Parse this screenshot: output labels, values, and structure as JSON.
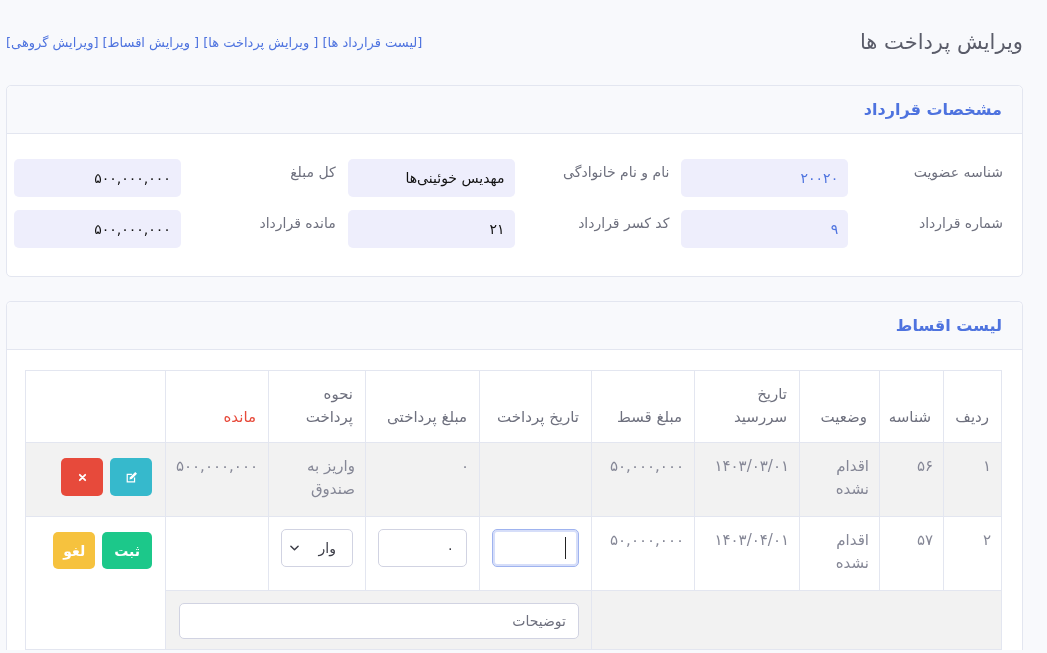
{
  "page": {
    "title": "ویرایش پرداخت ها",
    "links": [
      "[لیست قرارداد ها]",
      "[ ویرایش پرداخت ها]",
      "[ ویرایش اقساط]",
      "[ویرایش گروهی]"
    ]
  },
  "contract": {
    "title": "مشخصات قرارداد",
    "fields": [
      {
        "label": "شناسه عضویت",
        "value": "۲۰۰۲۰",
        "kind": "link"
      },
      {
        "label": "نام و نام خانوادگی",
        "value": "مهدیس خوئینی‌ها",
        "kind": "text"
      },
      {
        "label": "کل مبلغ",
        "value": "۵۰۰,۰۰۰,۰۰۰",
        "kind": "text"
      },
      {
        "label": "شماره قرارداد",
        "value": "۹",
        "kind": "link"
      },
      {
        "label": "کد کسر قرارداد",
        "value": "۲۱",
        "kind": "text"
      },
      {
        "label": "مانده قرارداد",
        "value": "۵۰۰,۰۰۰,۰۰۰",
        "kind": "text"
      }
    ]
  },
  "installments": {
    "title": "لیست اقساط",
    "columns": [
      {
        "label": "ردیف",
        "color": "#6e707e"
      },
      {
        "label": "شناسه",
        "color": "#6e707e"
      },
      {
        "label": "وضعیت",
        "color": "#6e707e"
      },
      {
        "label": "تاریخ سررسید",
        "color": "#6e707e"
      },
      {
        "label": "مبلغ قسط",
        "color": "#6e707e"
      },
      {
        "label": "تاریخ پرداخت",
        "color": "#6e707e"
      },
      {
        "label": "مبلغ پرداختی",
        "color": "#6e707e"
      },
      {
        "label": "نحوه پرداخت",
        "color": "#6e707e"
      },
      {
        "label": "مانده",
        "color": "#e74a3b"
      }
    ],
    "rows": [
      {
        "kind": "view",
        "row_number": "۱",
        "id": "۵۶",
        "status": "اقدام نشده",
        "due_date": "۱۴۰۳/۰۳/۰۱",
        "installment_amount": "۵۰,۰۰۰,۰۰۰",
        "paid_amount": "۰",
        "payment_method": "واریز به صندوق",
        "remaining": "۵۰۰,۰۰۰,۰۰۰",
        "actions": [
          {
            "kind": "edit"
          },
          {
            "kind": "delete"
          }
        ]
      },
      {
        "kind": "edit",
        "row_number": "۲",
        "id": "۵۷",
        "status": "اقدام نشده",
        "due_date": "۱۴۰۳/۰۴/۰۱",
        "installment_amount": "۵۰,۰۰۰,۰۰۰",
        "payment_date_field": {
          "focused": true
        },
        "paid_amount_field": {
          "value": "۰"
        },
        "payment_method_select": {
          "value": "وار"
        },
        "note_field": {
          "placeholder": "توضیحات"
        },
        "actions": [
          {
            "kind": "save",
            "label": "ثبت"
          },
          {
            "kind": "cancel",
            "label": "لغو"
          }
        ]
      }
    ]
  }
}
